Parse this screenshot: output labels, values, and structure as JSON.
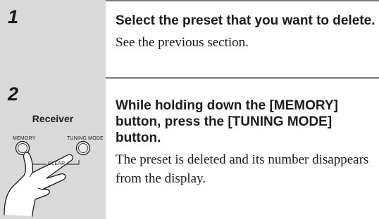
{
  "steps": [
    {
      "number": "1",
      "instruction": "Select the preset that you want to delete.",
      "note": "See the previous section."
    },
    {
      "number": "2",
      "device_label": "Receiver",
      "buttons": {
        "memory": "MEMORY",
        "tuning_mode": "TUNING MODE",
        "clear": "CLEAR"
      },
      "illustration_icon": "hand-pressing-two-buttons-icon",
      "instruction": "While holding down the [MEMORY] button, press the [TUNING MODE] button.",
      "note": "The preset is deleted and its number disappears from the display."
    }
  ]
}
